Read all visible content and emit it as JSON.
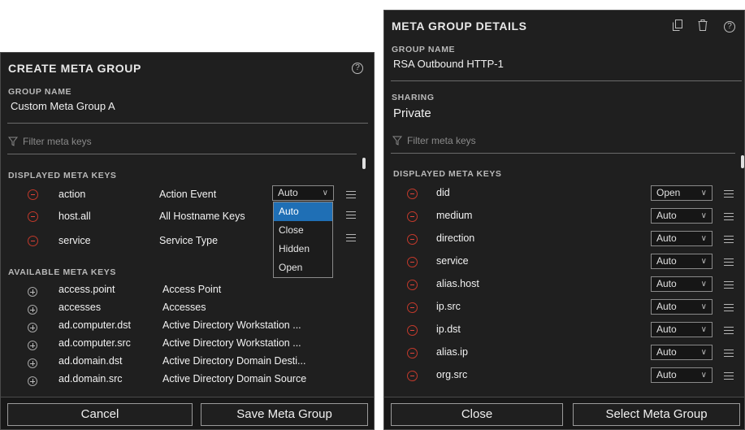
{
  "create": {
    "title": "CREATE META GROUP",
    "group_name_label": "GROUP NAME",
    "group_name": "Custom Meta Group A",
    "filter_placeholder": "Filter meta keys",
    "displayed_label": "DISPLAYED META KEYS",
    "displayed": [
      {
        "key": "action",
        "desc": "Action Event",
        "option": "Auto"
      },
      {
        "key": "host.all",
        "desc": "All Hostname Keys",
        "option": ""
      },
      {
        "key": "service",
        "desc": "Service Type",
        "option": ""
      }
    ],
    "dropdown_options": [
      "Auto",
      "Close",
      "Hidden",
      "Open"
    ],
    "available_label": "AVAILABLE META KEYS",
    "available": [
      {
        "key": "access.point",
        "desc": "Access Point"
      },
      {
        "key": "accesses",
        "desc": "Accesses"
      },
      {
        "key": "ad.computer.dst",
        "desc": "Active Directory Workstation ..."
      },
      {
        "key": "ad.computer.src",
        "desc": "Active Directory Workstation ..."
      },
      {
        "key": "ad.domain.dst",
        "desc": "Active Directory Domain Desti..."
      },
      {
        "key": "ad.domain.src",
        "desc": "Active Directory Domain Source"
      }
    ],
    "cancel_label": "Cancel",
    "save_label": "Save Meta Group"
  },
  "details": {
    "title": "META GROUP DETAILS",
    "group_name_label": "GROUP NAME",
    "group_name": "RSA Outbound HTTP-1",
    "sharing_label": "SHARING",
    "sharing": "Private",
    "filter_placeholder": "Filter meta keys",
    "displayed_label": "DISPLAYED META KEYS",
    "displayed": [
      {
        "key": "did",
        "option": "Open"
      },
      {
        "key": "medium",
        "option": "Auto"
      },
      {
        "key": "direction",
        "option": "Auto"
      },
      {
        "key": "service",
        "option": "Auto"
      },
      {
        "key": "alias.host",
        "option": "Auto"
      },
      {
        "key": "ip.src",
        "option": "Auto"
      },
      {
        "key": "ip.dst",
        "option": "Auto"
      },
      {
        "key": "alias.ip",
        "option": "Auto"
      },
      {
        "key": "org.src",
        "option": "Auto"
      }
    ],
    "close_label": "Close",
    "select_label": "Select Meta Group"
  },
  "icons": {
    "help": "help-icon",
    "copy": "copy-icon",
    "trash": "trash-icon",
    "filter": "filter-icon",
    "remove": "remove-circle-icon",
    "add": "add-circle-icon",
    "drag": "drag-handle-icon",
    "chevron": "chevron-down-icon"
  },
  "colors": {
    "panel_bg": "#1f1f1f",
    "remove_red": "#e0443a",
    "selected_blue": "#1f6fb5"
  }
}
